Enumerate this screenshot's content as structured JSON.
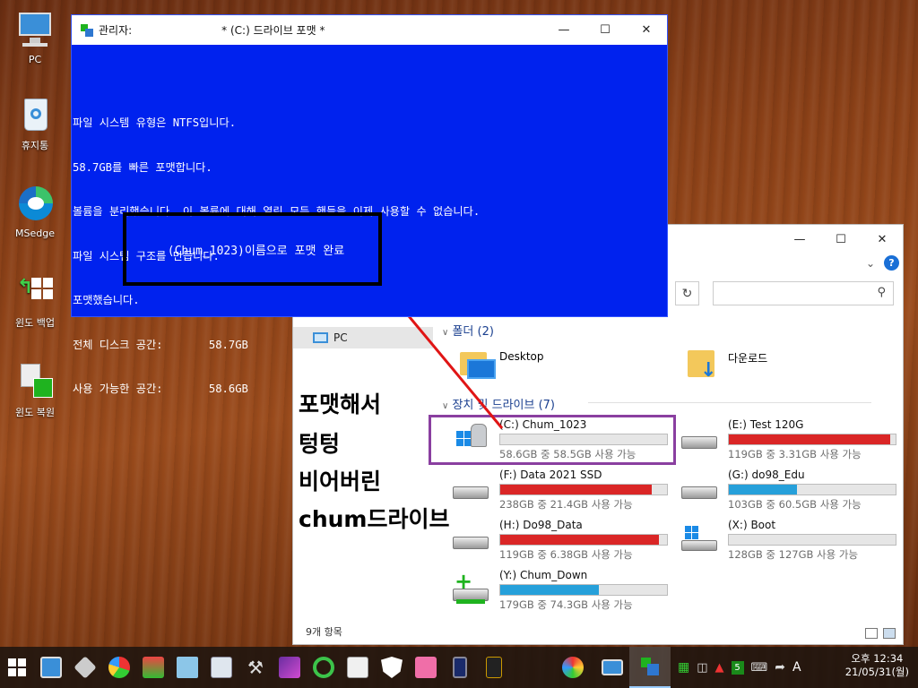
{
  "desktop": {
    "icons": [
      {
        "label": "PC"
      },
      {
        "label": "휴지통"
      },
      {
        "label": "MSedge"
      },
      {
        "label": "윈도 백업"
      },
      {
        "label": "윈도 복원"
      }
    ]
  },
  "console": {
    "title_left": "관리자:",
    "title_center": "*  (C:) 드라이브 포맷  *",
    "lines": [
      "파일 시스템 유형은 NTFS입니다.",
      "58.7GB를 빠른 포맷합니다.",
      "볼륨을 분리했습니다. 이 볼륨에 대해 열린 모든 핸들을 이제 사용할 수 없습니다.",
      "파일 시스템 구조를 만듭니다.",
      "포맷했습니다.",
      "전체 디스크 공간:       58.7GB",
      "사용 가능한 공간:       58.6GB"
    ],
    "annotation": "(Chum_1023)이름으로 포맷 완료"
  },
  "overlay_note": [
    "포맷해서",
    "텅텅",
    "비어버린",
    "chum드라이브"
  ],
  "explorer": {
    "nav_pc": "PC",
    "folders_header": "폴더 (2)",
    "folders": [
      {
        "name": "Desktop"
      },
      {
        "name": "다운로드"
      }
    ],
    "drives_header": "장치 및 드라이브 (7)",
    "drives": [
      {
        "name": "(C:) Chum_1023",
        "info": "58.6GB 중 58.5GB 사용 가능",
        "used": 0.0,
        "color": "#26a0da"
      },
      {
        "name": "(E:) Test 120G",
        "info": "119GB 중 3.31GB 사용 가능",
        "used": 0.97,
        "color": "#da2626"
      },
      {
        "name": "(F:) Data 2021 SSD",
        "info": "238GB 중 21.4GB 사용 가능",
        "used": 0.91,
        "color": "#da2626"
      },
      {
        "name": "(G:) do98_Edu",
        "info": "103GB 중 60.5GB 사용 가능",
        "used": 0.41,
        "color": "#26a0da"
      },
      {
        "name": "(H:) Do98_Data",
        "info": "119GB 중 6.38GB 사용 가능",
        "used": 0.95,
        "color": "#da2626"
      },
      {
        "name": "(X:) Boot",
        "info": "128GB 중 127GB 사용 가능",
        "used": 0.0,
        "color": "#26a0da"
      },
      {
        "name": "(Y:) Chum_Down",
        "info": "179GB 중 74.3GB 사용 가능",
        "used": 0.59,
        "color": "#26a0da"
      }
    ],
    "status": "9개 항목"
  },
  "taskbar": {
    "clock_time": "오후 12:34",
    "clock_date": "21/05/31(월)",
    "tray_count": "5",
    "ime": "A"
  },
  "colors": {
    "console_bg": "#0022ee",
    "highlight_box": "#8a3fa0",
    "arrow": "#e01515"
  }
}
